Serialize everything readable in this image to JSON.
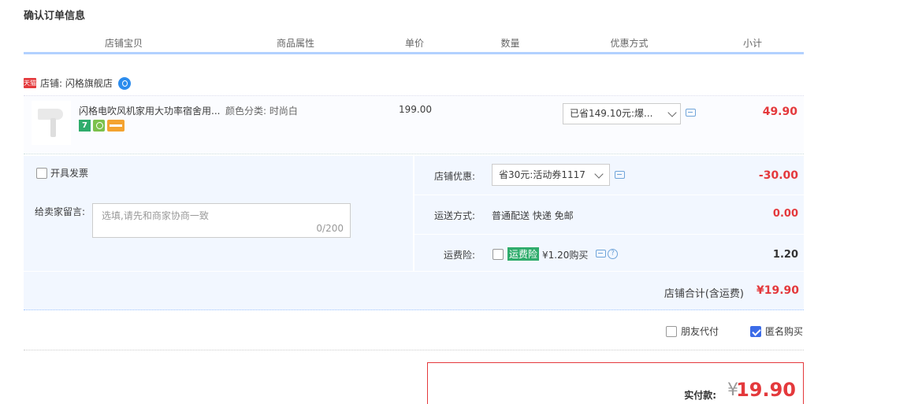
{
  "title": "确认订单信息",
  "columns": [
    "店铺宝贝",
    "商品属性",
    "单价",
    "数量",
    "优惠方式",
    "小计"
  ],
  "store": {
    "badge": "天猫",
    "label": "店铺: 闪格旗舰店"
  },
  "item": {
    "title": "闪格电吹风机家用大功率宿舍用...",
    "attribute": "颜色分类: 时尚白",
    "price": "199.00",
    "promo_select": "已省149.10元:爆...",
    "subtotal": "49.90"
  },
  "invoice": {
    "label": "开具发票",
    "checked": false
  },
  "memo": {
    "label": "给卖家留言:",
    "placeholder": "选填,请先和商家协商一致",
    "counter": "0/200"
  },
  "shop_discount": {
    "label": "店铺优惠:",
    "select": "省30元:活动券1117",
    "value": "-30.00"
  },
  "shipping": {
    "label": "运送方式:",
    "text": "普通配送 快递 免邮",
    "value": "0.00"
  },
  "insurance": {
    "label": "运费险:",
    "tag": "运费险",
    "text": "¥1.20购买",
    "value": "1.20",
    "checked": false
  },
  "store_total": {
    "label": "店铺合计(含运费)",
    "value": "¥19.90"
  },
  "options": {
    "friend_pay": "朋友代付",
    "friend_pay_checked": false,
    "anonymous": "匿名购买",
    "anonymous_checked": true
  },
  "payment": {
    "label": "实付款:",
    "currency": "¥",
    "amount": "19.90"
  },
  "colors": {
    "accent_red": "#e4393c",
    "header_rule": "#b2d1ff",
    "panel_bg": "#f2f7ff",
    "insurance_green": "#2fac6c"
  }
}
